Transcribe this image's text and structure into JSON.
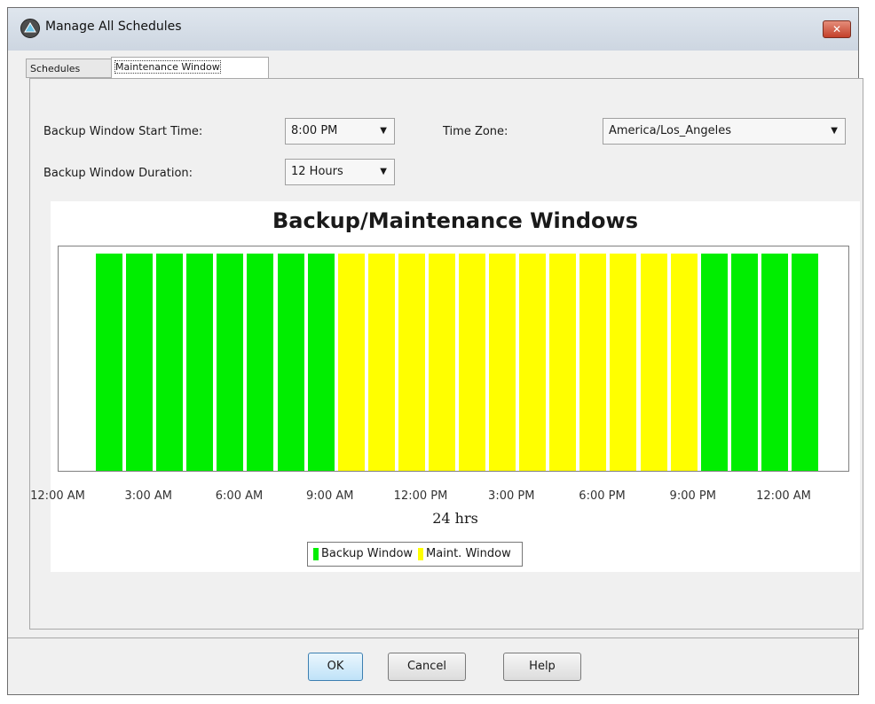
{
  "window": {
    "title": "Manage All Schedules",
    "close_label": "✕"
  },
  "tabs": [
    {
      "label": "Schedules"
    },
    {
      "label": "Maintenance Window"
    }
  ],
  "form": {
    "start_time_label": "Backup Window Start Time:",
    "start_time_value": "8:00 PM",
    "duration_label": "Backup Window Duration:",
    "duration_value": "12 Hours",
    "timezone_label": "Time Zone:",
    "timezone_value": "America/Los_Angeles"
  },
  "colors": {
    "backup": "#00ee00",
    "maint": "#ffff00"
  },
  "chart_data": {
    "type": "bar",
    "title": "Backup/Maintenance Windows",
    "xlabel": "24 hrs",
    "x_ticks": [
      "12:00 AM",
      "3:00 AM",
      "6:00 AM",
      "9:00 AM",
      "12:00 PM",
      "3:00 PM",
      "6:00 PM",
      "9:00 PM",
      "12:00 AM"
    ],
    "hours": [
      0,
      1,
      2,
      3,
      4,
      5,
      6,
      7,
      8,
      9,
      10,
      11,
      12,
      13,
      14,
      15,
      16,
      17,
      18,
      19,
      20,
      21,
      22,
      23
    ],
    "series": [
      {
        "name": "Backup Window",
        "color": "#00ee00",
        "values": [
          1,
          1,
          1,
          1,
          1,
          1,
          1,
          1,
          0,
          0,
          0,
          0,
          0,
          0,
          0,
          0,
          0,
          0,
          0,
          0,
          1,
          1,
          1,
          1
        ]
      },
      {
        "name": "Maint. Window",
        "color": "#ffff00",
        "values": [
          0,
          0,
          0,
          0,
          0,
          0,
          0,
          0,
          1,
          1,
          1,
          1,
          1,
          1,
          1,
          1,
          1,
          1,
          1,
          1,
          0,
          0,
          0,
          0
        ]
      }
    ],
    "legend_position": "bottom-center"
  },
  "buttons": {
    "ok": "OK",
    "cancel": "Cancel",
    "help": "Help"
  }
}
